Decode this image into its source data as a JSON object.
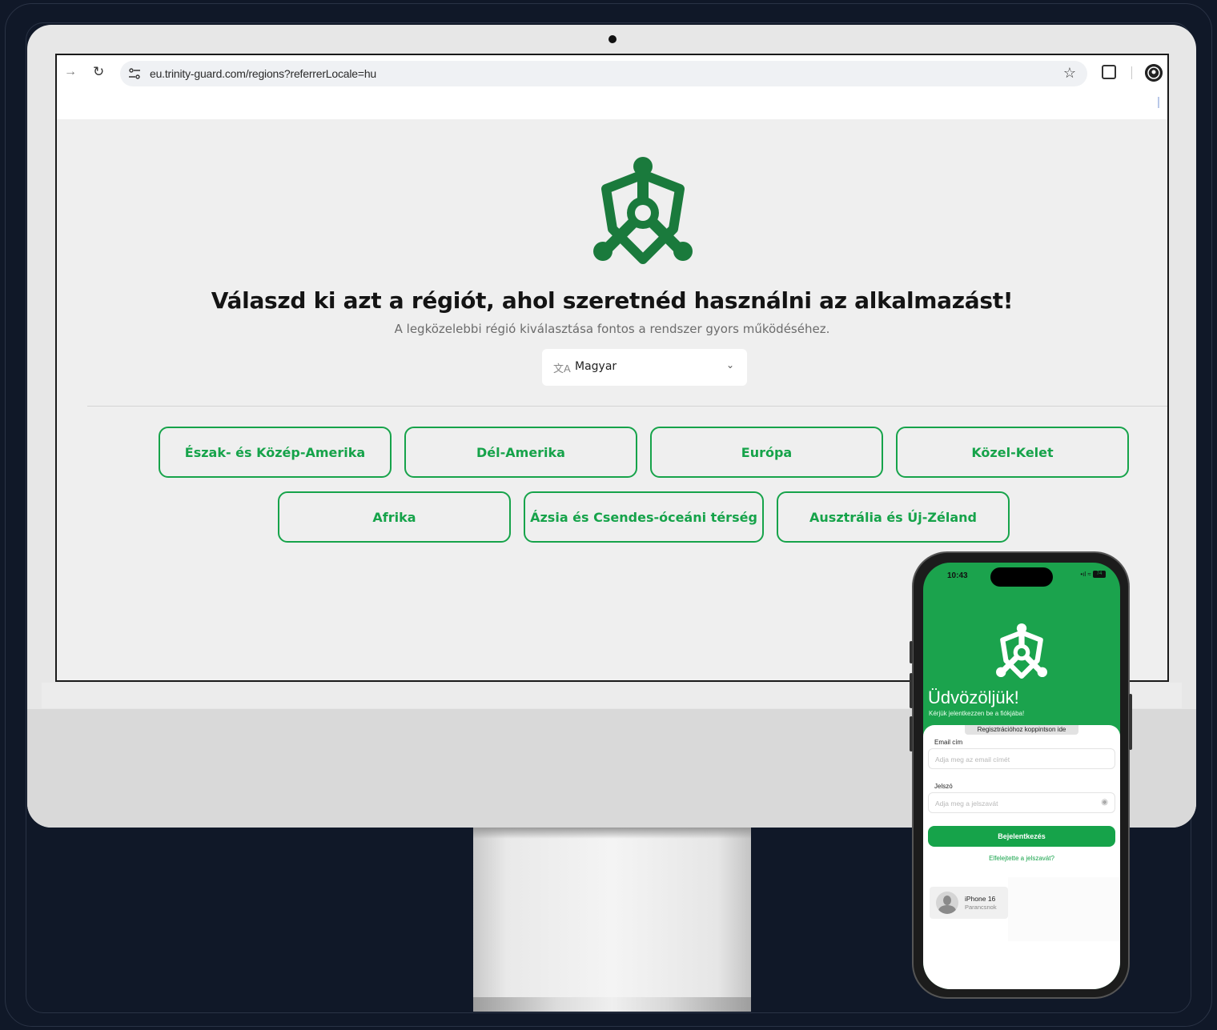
{
  "browser": {
    "url": "eu.trinity-guard.com/regions?referrerLocale=hu",
    "forward_glyph": "→",
    "reload_glyph": "↻",
    "star_glyph": "☆"
  },
  "page": {
    "headline": "Válaszd ki azt a régiót, ahol szeretnéd használni az alkalmazást!",
    "subline": "A legközelebbi régió kiválasztása fontos a rendszer gyors működéséhez.",
    "language": {
      "icon": "translate-icon",
      "icon_glyph": "文A",
      "selected": "Magyar",
      "chevron": "⌄"
    },
    "regions": [
      "Észak- és Közép-Amerika",
      "Dél-Amerika",
      "Európa",
      "Közel-Kelet",
      "Afrika",
      "Ázsia és Csendes-óceáni térség",
      "Ausztrália és Új-Zéland"
    ]
  },
  "phone": {
    "time": "10:43",
    "signal_glyph": "•ıl ≈",
    "battery": "74",
    "welcome": "Üdvözöljük!",
    "welcome_sub": "Kérjük jelentkezzen be a fiókjába!",
    "register_pill": "Regisztrációhoz koppintson ide",
    "email_label": "Email cím",
    "email_placeholder": "Adja meg az email címét",
    "password_label": "Jelszó",
    "password_placeholder": "Adja meg a jelszavát",
    "eye_glyph": "◉",
    "login_button": "Bejelentkezés",
    "forgot": "Elfelejtette a jelszavát?",
    "airdrop": {
      "name": "iPhone 16",
      "sub": "Parancsnok"
    }
  },
  "colors": {
    "brand_green": "#16a34a",
    "logo_green": "#1a7a3c",
    "phone_green": "#1ba34d",
    "backdrop": "#101828"
  }
}
